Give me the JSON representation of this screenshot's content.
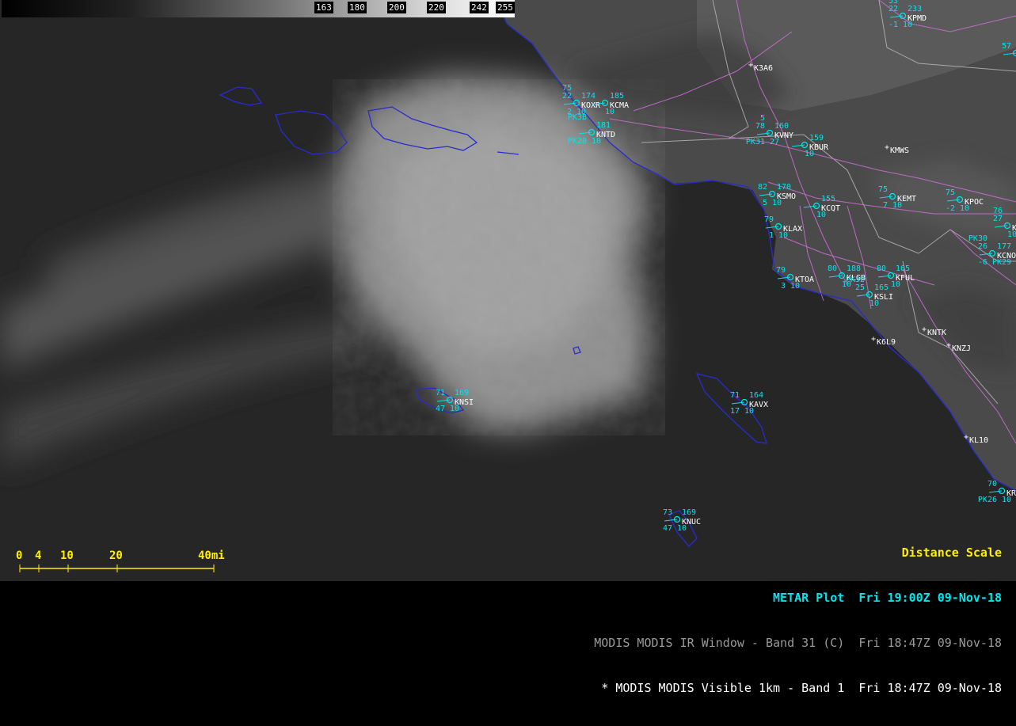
{
  "colorbar": {
    "ticks": [
      "163",
      "180",
      "200",
      "220",
      "242",
      "255"
    ]
  },
  "legend": {
    "distance_scale": "Distance Scale",
    "metar_name": "METAR Plot",
    "metar_time": "Fri 19:00Z 09-Nov-18",
    "ir_name": "MODIS MODIS IR Window - Band 31 (C)",
    "ir_time": "Fri 18:47Z 09-Nov-18",
    "vis_name": "* MODIS MODIS Visible 1km - Band 1",
    "vis_time": "Fri 18:47Z 09-Nov-18"
  },
  "scale_bar": {
    "labels": [
      "0",
      "4",
      "10",
      "20",
      "40mi"
    ],
    "color": "#ffef00"
  },
  "colors": {
    "station": "#00e5ee",
    "unplotted_station": "#ffffff",
    "coast": "#1c1caa",
    "roads": "#d070d8",
    "boundaries": "#bbbbbb",
    "legend_grey": "#9a9a9a",
    "legend_white": "#ffffff",
    "distance_yellow": "#ffef00"
  },
  "stations": [
    {
      "id": "KPMD",
      "t": "22",
      "td": "-1",
      "p": "233",
      "tl": "53",
      "v": "10"
    },
    {
      "id": "KOXR",
      "t": "22",
      "td": "2",
      "p": "174",
      "tl": "75",
      "v": "10"
    },
    {
      "id": "KCMA",
      "t": "",
      "td": "",
      "p": "185",
      "tl": "",
      "v": "10"
    },
    {
      "id": "KNTD",
      "t": "",
      "td": "PK20",
      "p": "181",
      "tl": "PK3B",
      "v": "10"
    },
    {
      "id": "KVNY",
      "t": "78",
      "td": "PK31",
      "p": "160",
      "tl": "5",
      "v": "27"
    },
    {
      "id": "KBUR",
      "t": "",
      "td": "",
      "p": "159",
      "tl": "",
      "v": "10"
    },
    {
      "id": "KSMO",
      "t": "82",
      "td": "5",
      "p": "170",
      "tl": "",
      "v": "10"
    },
    {
      "id": "KCQT",
      "t": "",
      "td": "",
      "p": "155",
      "tl": "",
      "v": "10"
    },
    {
      "id": "KEMT",
      "t": "75",
      "td": "7",
      "p": "",
      "tl": "",
      "v": "10"
    },
    {
      "id": "KPOC",
      "t": "75",
      "td": "-2",
      "p": "",
      "tl": "",
      "v": "10"
    },
    {
      "id": "KLAX",
      "t": "79",
      "td": "1",
      "p": "",
      "tl": "",
      "v": "10"
    },
    {
      "id": "KTOA",
      "t": "79",
      "td": "3",
      "p": "",
      "tl": "",
      "v": "10"
    },
    {
      "id": "KLGB",
      "t": "80",
      "td": "",
      "p": "188",
      "tl": "",
      "v": "10"
    },
    {
      "id": "KFUL",
      "t": "80",
      "td": "",
      "p": "165",
      "tl": "",
      "v": "10"
    },
    {
      "id": "KSLI",
      "t": "25",
      "td": "",
      "p": "165",
      "tl": "PK32",
      "v": "10"
    },
    {
      "id": "KCNO",
      "t": "26",
      "td": "-6",
      "p": "177",
      "tl": "PK30",
      "v": "PK29"
    },
    {
      "id": "KONT",
      "t": "27",
      "td": "",
      "p": "",
      "tl": "76",
      "v": "10"
    },
    {
      "id": "KNSI",
      "t": "71",
      "td": "47",
      "p": "169",
      "tl": "",
      "v": "10"
    },
    {
      "id": "KAVX",
      "t": "71",
      "td": "17",
      "p": "164",
      "tl": "",
      "v": "10"
    },
    {
      "id": "KNUC",
      "t": "73",
      "td": "47",
      "p": "169",
      "tl": "",
      "v": "10"
    },
    {
      "id": "KRNM",
      "t": "70",
      "td": "PK26",
      "p": "",
      "tl": "",
      "v": "10"
    },
    {
      "id": "KTRM",
      "t": "57",
      "td": "",
      "p": "",
      "tl": "",
      "v": ""
    }
  ],
  "plain_stations": [
    "K3A6",
    "KMWS",
    "KNTK",
    "KNZJ",
    "K6L9",
    "KL10"
  ]
}
